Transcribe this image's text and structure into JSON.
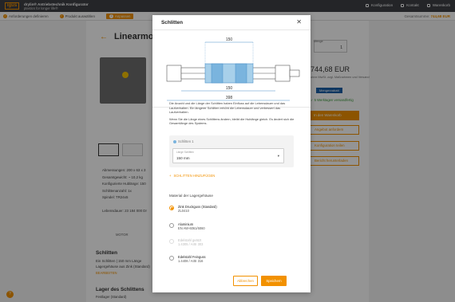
{
  "header": {
    "logo": "igus",
    "brand_line1": "drylin® Antriebstechnik Konfigurator",
    "brand_line2": "plastics for longer life®",
    "links": [
      "Konfiguration",
      "Kontakt",
      "Warenkorb"
    ]
  },
  "progress": {
    "steps": [
      {
        "num": "✓",
        "label": "Anforderungen definieren"
      },
      {
        "num": "✓",
        "label": "Produkt auswählen"
      },
      {
        "num": "3",
        "label": "Anpassen"
      }
    ],
    "total_label": "Gesamtsumme",
    "total_value": "744,68 EUR"
  },
  "background": {
    "title": "Linearmo",
    "specs": [
      "Abmessungen:   200 x 63 x 3",
      "Gesamtgewicht:   ~ 10,2 kg",
      "Konfigurierte Hublänge:   150",
      "Schlittenanzahl:   1x",
      "Spindel:   TR24x5"
    ],
    "lebensdauer": "Lebensdauer:   23 184 000 Dr",
    "motor": "MOTOR",
    "schlitten_heading": "Schlitten",
    "schlitten_lines": [
      "Ein Schlitten | 150 mm Länge",
      "Lagergehäuse aus Zink (Standard)"
    ],
    "bearbeiten": "BEARBEITEN",
    "lager_heading": "Lager des Schlittens",
    "lager_line": "Festlager (Standard)",
    "qty_label": "Menge",
    "qty_value": "1",
    "price": "744,68 EUR",
    "price_note_1": "ohne MwSt. zzgl. Maßnahmen und Versand",
    "price_note_2": "Mengenrabatt",
    "shipping": "✓ 5 Werktagen versandfertig",
    "side_buttons": [
      "In den Warenkorb",
      "Angebot anfordern",
      "Konfiguration teilen",
      "Bericht herunterladen"
    ]
  },
  "modal": {
    "title": "Schlitten",
    "diagram": {
      "dim_slider": "150",
      "dim_stroke": "150",
      "dim_total": "398"
    },
    "desc_1": "Die Anzahl und die Länge der Schlitten haben Einfluss auf die Lebensdauer und das Laufverhalten. Ein längerer Schlitten erhöht die Lebensdauer und verbessert das Laufverhalten.",
    "desc_2": "Wenn Sie die Länge eines Schlittens ändern, bleibt die Hublänge gleich. Es ändert sich die Gesamtlänge des Systems.",
    "card_title": "Schlitten 1",
    "select_label": "Länge Schlitten",
    "select_value": "150 mm",
    "add_link": "SCHLITTEN HINZUFÜGEN",
    "material_heading": "Material der Lagergehäuse",
    "options": [
      {
        "name": "Zink Druckguss (Standard)",
        "code": "ZL0410",
        "state": "selected"
      },
      {
        "name": "Aluminium",
        "code": "EN AW-6061/6060",
        "state": "enabled"
      },
      {
        "name": "Edelstahl geätzt",
        "code": "1.4305 / AISI 303",
        "state": "disabled"
      },
      {
        "name": "Edelstahl Feinguss",
        "code": "1.4408 / AISI 316",
        "state": "enabled"
      }
    ],
    "cancel": "Abbrechen",
    "save": "Speichern"
  },
  "colors": {
    "accent": "#f29100",
    "header": "#3e4046",
    "overlay": "rgba(0,0,0,0.42)"
  }
}
